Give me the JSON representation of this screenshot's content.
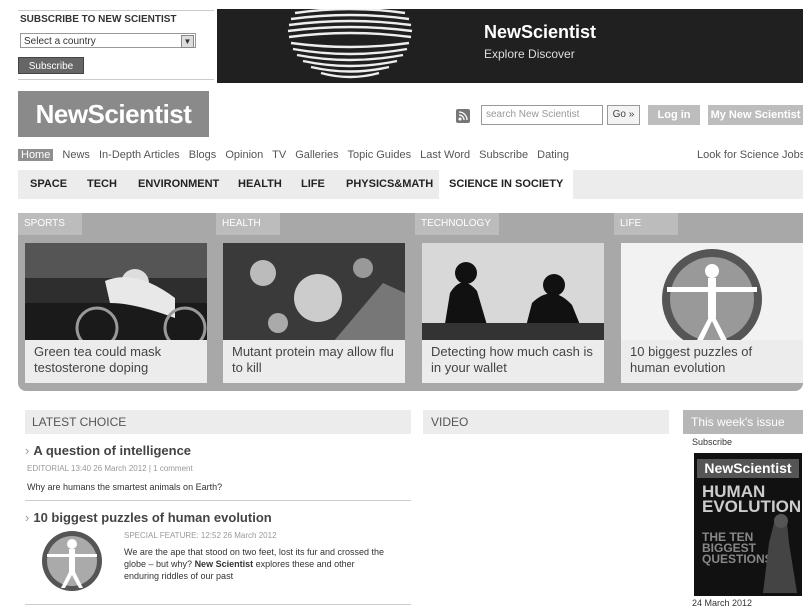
{
  "subscribe": {
    "title": "SUBSCRIBE TO NEW SCIENTIST",
    "country_placeholder": "Select a country",
    "button": "Subscribe"
  },
  "banner": {
    "brand": "NewScientist",
    "tagline": "Explore  Discover"
  },
  "header": {
    "logo": "NewScientist",
    "search_placeholder": "search New Scientist",
    "go": "Go »",
    "login": "Log in",
    "my_account": "My New Scientist"
  },
  "nav_primary": {
    "items": [
      "Home",
      "News",
      "In-Depth Articles",
      "Blogs",
      "Opinion",
      "TV",
      "Galleries",
      "Topic Guides",
      "Last Word",
      "Subscribe",
      "Dating"
    ],
    "right": "Look for Science Jobs"
  },
  "nav_sections": [
    "SPACE",
    "TECH",
    "ENVIRONMENT",
    "HEALTH",
    "LIFE",
    "PHYSICS&MATH",
    "SCIENCE IN SOCIETY"
  ],
  "features": [
    {
      "tag": "SPORTS",
      "caption": "Green tea could mask testosterone doping"
    },
    {
      "tag": "HEALTH",
      "caption": "Mutant protein may allow flu to kill"
    },
    {
      "tag": "TECHNOLOGY",
      "caption": "Detecting how much cash is in your wallet"
    },
    {
      "tag": "LIFE",
      "caption": "10 biggest puzzles of human evolution"
    }
  ],
  "latest_choice": {
    "heading": "LATEST CHOICE",
    "articles": [
      {
        "title": "A question of intelligence",
        "meta": "EDITORIAL  13:40 26 March 2012  | 1 comment",
        "desc": "Why are humans the smartest animals on Earth?"
      },
      {
        "title": "10 biggest puzzles of human evolution",
        "meta": "SPECIAL FEATURE:  12:52 26 March 2012",
        "desc_start": "We are the ape that stood on two feet, lost its fur and crossed the globe – but why? ",
        "desc_bold": "New Scientist",
        "desc_end": " explores these and other enduring riddles of our past"
      }
    ]
  },
  "video": {
    "heading": "VIDEO"
  },
  "issue": {
    "heading": "This week's issue",
    "subscribe": "Subscribe",
    "cover_brand": "NewScientist",
    "cover_headline": "HUMAN EVOLUTION",
    "cover_sub": "THE TEN BIGGEST QUESTIONS",
    "date": "24 March 2012"
  },
  "colors": {
    "banner_bg": "#202020",
    "logo_bg": "#8a8a8a",
    "feature_bg": "#a8a8a8"
  }
}
